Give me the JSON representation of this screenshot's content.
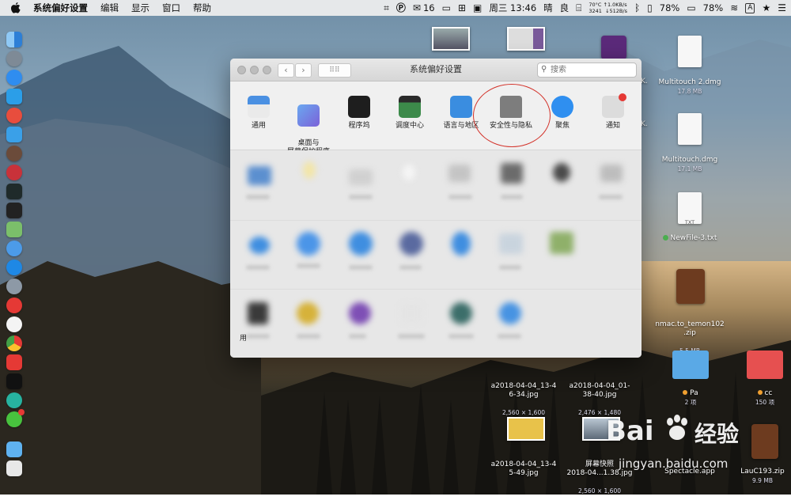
{
  "menubar": {
    "app_name": "系统偏好设置",
    "menus": [
      "编辑",
      "显示",
      "窗口",
      "帮助"
    ],
    "wechat_count": "16",
    "cpu_temp": "70°C",
    "cpu_value": "3241",
    "net_up": "↑1.0KB/s",
    "net_down": "↓512B/s",
    "datetime": "周三 13:46",
    "weather": "晴",
    "air_quality": "良",
    "battery_1": "78%",
    "battery_2": "78%",
    "input_method": "A"
  },
  "window": {
    "title": "系统偏好设置",
    "search_placeholder": "搜索",
    "top_row": [
      {
        "label": "通用",
        "icon": "general-icon"
      },
      {
        "label": "桌面与\n屏幕保护程序",
        "icon": "desktop-screensaver-icon"
      },
      {
        "label": "程序坞",
        "icon": "dock-icon"
      },
      {
        "label": "调度中心",
        "icon": "mission-control-icon"
      },
      {
        "label": "语言与地区",
        "icon": "language-region-icon"
      },
      {
        "label": "安全性与隐私",
        "icon": "security-privacy-icon"
      },
      {
        "label": "聚焦",
        "icon": "spotlight-icon"
      },
      {
        "label": "通知",
        "icon": "notifications-icon"
      }
    ],
    "partial_label": "用"
  },
  "desktop_icons": [
    {
      "name": "Multitouch 2.dmg",
      "size": "17.8 MB"
    },
    {
      "name": "Multitouch.dmg",
      "size": "17.1 MB"
    },
    {
      "name": "NewFile-3.txt",
      "size": "",
      "file_type": "TXT"
    },
    {
      "name": "nmac.to_temon102\n.zip",
      "size": "5.5 MB"
    },
    {
      "name": "Pa",
      "size": "2 项"
    },
    {
      "name": "cc",
      "size": "150 项"
    },
    {
      "name": "a2018-04-04_13-4\n6-34.jpg",
      "size": "2,560 × 1,600"
    },
    {
      "name": "a2018-04-04_01-\n38-40.jpg",
      "size": "2,476 × 1,480"
    },
    {
      "name": "a2018-04-04_13-4\n5-49.jpg",
      "size": ""
    },
    {
      "name": "屏幕快照\n2018-04...1.38.jpg",
      "size": "2,560 × 1,600"
    },
    {
      "name": "Spectacle.app",
      "size": ""
    },
    {
      "name": "LauC193.zip",
      "size": "9.9 MB"
    }
  ],
  "partial_labels": [
    "K.",
    "K."
  ],
  "watermark": {
    "brand_left": "Bai",
    "brand_right": "经验",
    "url": "jingyan.baidu.com"
  },
  "colors": {
    "annotation": "#d3322a",
    "menubar": "#f0f0f0",
    "folder_blue": "#5aa9e6",
    "folder_red": "#e65050"
  }
}
